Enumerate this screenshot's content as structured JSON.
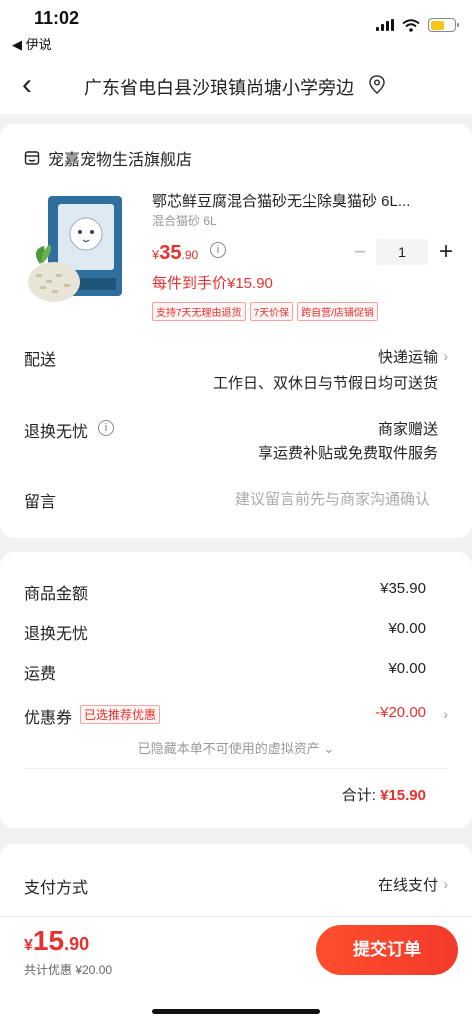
{
  "status_bar": {
    "time": "11:02",
    "back_app": "◀ 伊说"
  },
  "nav": {
    "title": "广东省电白县沙琅镇尚塘小学旁边"
  },
  "order": {
    "store_name": "宠嘉宠物生活旗舰店",
    "product_title": "鄂芯鲜豆腐混合猫砂无尘除臭猫砂 6L...",
    "product_spec": "混合猫砂 6L",
    "price_yen": "¥",
    "price_int": "35",
    "price_dec": ".90",
    "quantity": "1",
    "final_price": "每件到手价¥15.90",
    "badges": [
      "支持7天无理由退货",
      "7天价保",
      "跨自营/店铺促销"
    ],
    "delivery_label": "配送",
    "delivery_method": "快递运输",
    "delivery_note": "工作日、双休日与节假日均可送货",
    "return_label": "退换无忧",
    "return_value": "商家赠送",
    "return_note": "享运费补贴或免费取件服务",
    "message_label": "留言",
    "message_placeholder": "建议留言前先与商家沟通确认"
  },
  "fees": {
    "goods_label": "商品金额",
    "goods_value": "¥35.90",
    "return_label": "退换无忧",
    "return_value": "¥0.00",
    "shipping_label": "运费",
    "shipping_value": "¥0.00",
    "coupon_label": "优惠券",
    "coupon_tag": "已选推荐优惠",
    "coupon_value": "-¥20.00",
    "hidden_note": "已隐藏本单不可使用的虚拟资产 ⌄",
    "total_label": "合计:",
    "total_value": "¥15.90"
  },
  "payment": {
    "label": "支付方式",
    "value": "在线支付"
  },
  "bottom": {
    "price_yen": "¥",
    "price_int": "15",
    "price_dec": ".90",
    "discount_note": "共计优惠 ¥20.00",
    "submit_label": "提交订单"
  }
}
